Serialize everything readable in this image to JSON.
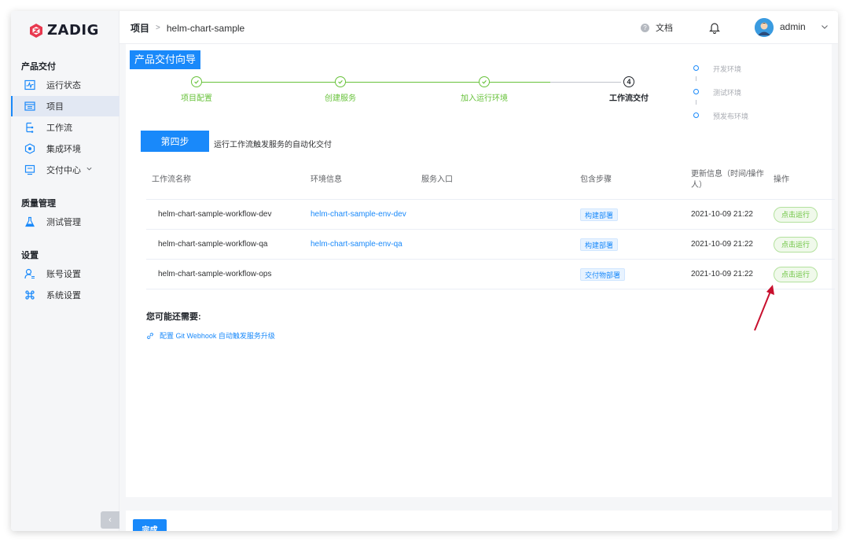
{
  "app": {
    "logo_text": "ZADIG"
  },
  "sidebar": {
    "groups": [
      {
        "title": "产品交付",
        "items": [
          {
            "label": "运行状态",
            "icon": "monitor-icon"
          },
          {
            "label": "项目",
            "icon": "project-icon",
            "active": true
          },
          {
            "label": "工作流",
            "icon": "workflow-icon"
          },
          {
            "label": "集成环境",
            "icon": "integration-env-icon"
          },
          {
            "label": "交付中心",
            "icon": "delivery-center-icon",
            "has_caret": true
          }
        ]
      },
      {
        "title": "质量管理",
        "items": [
          {
            "label": "测试管理",
            "icon": "flask-icon"
          }
        ]
      },
      {
        "title": "设置",
        "items": [
          {
            "label": "账号设置",
            "icon": "account-icon"
          },
          {
            "label": "系统设置",
            "icon": "command-icon"
          }
        ]
      }
    ],
    "collapse_label": "‹"
  },
  "header": {
    "breadcrumb_root": "项目",
    "breadcrumb_sep": ">",
    "breadcrumb_current": "helm-chart-sample",
    "docs_label": "文档",
    "user_name": "admin"
  },
  "guide": {
    "title": "产品交付向导",
    "steps": [
      {
        "label": "项目配置",
        "done": true
      },
      {
        "label": "创建服务",
        "done": true
      },
      {
        "label": "加入运行环境",
        "done": true
      },
      {
        "label": "工作流交付",
        "done": false,
        "number": "4"
      }
    ],
    "environments": [
      "开发环境",
      "测试环境",
      "预发布环境"
    ],
    "current_step_tag": "第四步",
    "current_step_desc": "运行工作流触发服务的自动化交付"
  },
  "table": {
    "headers": [
      "工作流名称",
      "环境信息",
      "服务入口",
      "包含步骤",
      "更新信息（时间/操作人）",
      "操作"
    ],
    "rows": [
      {
        "name": "helm-chart-sample-workflow-dev",
        "env": "helm-chart-sample-env-dev",
        "entry": "",
        "steps": "构建部署",
        "updated": "2021-10-09 21:22",
        "action": "点击运行"
      },
      {
        "name": "helm-chart-sample-workflow-qa",
        "env": "helm-chart-sample-env-qa",
        "entry": "",
        "steps": "构建部署",
        "updated": "2021-10-09 21:22",
        "action": "点击运行"
      },
      {
        "name": "helm-chart-sample-workflow-ops",
        "env": "",
        "entry": "",
        "steps": "交付物部署",
        "updated": "2021-10-09 21:22",
        "action": "点击运行"
      }
    ]
  },
  "suggestions": {
    "title": "您可能还需要:",
    "link": "配置 Git Webhook 自动触发服务升级"
  },
  "footer": {
    "done_label": "完成"
  },
  "colors": {
    "accent": "#1989fa",
    "success": "#67c23a",
    "annotation_arrow": "#c8102e"
  }
}
